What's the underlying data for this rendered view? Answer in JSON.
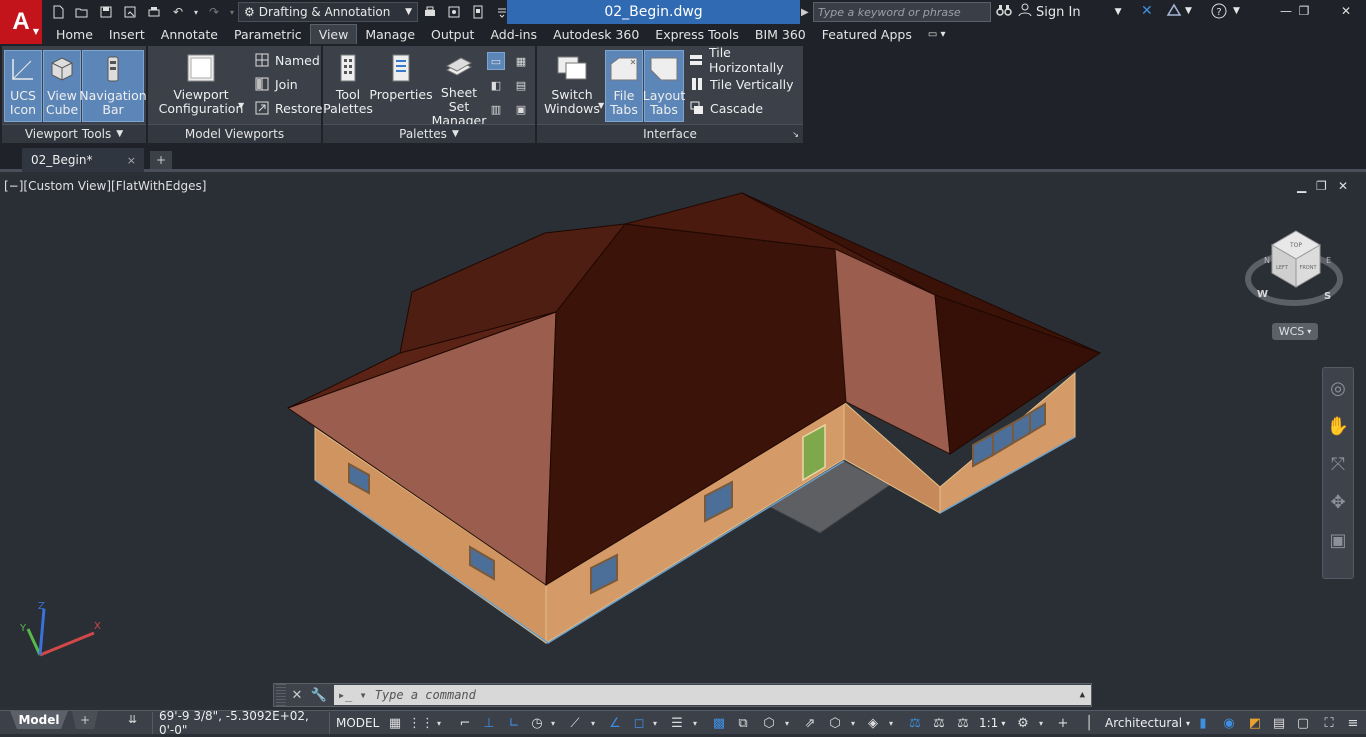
{
  "titlebar": {
    "app_logo": "A",
    "workspace": "Drafting & Annotation",
    "document": "02_Begin.dwg",
    "search_placeholder": "Type a keyword or phrase",
    "sign_in": "Sign In",
    "help": "?"
  },
  "ribbon_tabs": [
    "Home",
    "Insert",
    "Annotate",
    "Parametric",
    "View",
    "Manage",
    "Output",
    "Add-ins",
    "Autodesk 360",
    "Express Tools",
    "BIM 360",
    "Featured Apps"
  ],
  "ribbon": {
    "viewport_tools": {
      "title": "Viewport Tools",
      "ucs_icon": [
        "UCS",
        "Icon"
      ],
      "view_cube": [
        "View",
        "Cube"
      ],
      "navigation_bar": [
        "Navigation",
        "Bar"
      ]
    },
    "model_viewports": {
      "title": "Model Viewports",
      "viewport_configuration": [
        "Viewport",
        "Configuration"
      ],
      "named": "Named",
      "join": "Join",
      "restore": "Restore"
    },
    "palettes": {
      "title": "Palettes",
      "tool_palettes": [
        "Tool",
        "Palettes"
      ],
      "properties": "Properties",
      "sheet_set_manager": [
        "Sheet Set",
        "Manager"
      ]
    },
    "interface": {
      "title": "Interface",
      "switch_windows": [
        "Switch",
        "Windows"
      ],
      "file_tabs": [
        "File",
        "Tabs"
      ],
      "layout_tabs": [
        "Layout",
        "Tabs"
      ],
      "tile_horizontally": "Tile Horizontally",
      "tile_vertically": "Tile Vertically",
      "cascade": "Cascade"
    }
  },
  "file_tab": {
    "name": "02_Begin*",
    "close": "×",
    "new": "+"
  },
  "viewport": {
    "label": "[−][Custom View][FlatWithEdges]",
    "viewcube_faces": {
      "top": "TOP",
      "left": "LEFT",
      "front": "FRONT"
    },
    "compass": {
      "w": "W",
      "s": "S",
      "n": "N",
      "e": "E"
    },
    "wcs": "WCS"
  },
  "command_line": {
    "placeholder": "Type a command"
  },
  "status_bar": {
    "model_tab": "Model",
    "add_layout": "+",
    "coordinates": "69'-9 3/8\", -5.3092E+02, 0'-0\"",
    "space": "MODEL",
    "scale": "1:1",
    "units": "Architectural"
  }
}
